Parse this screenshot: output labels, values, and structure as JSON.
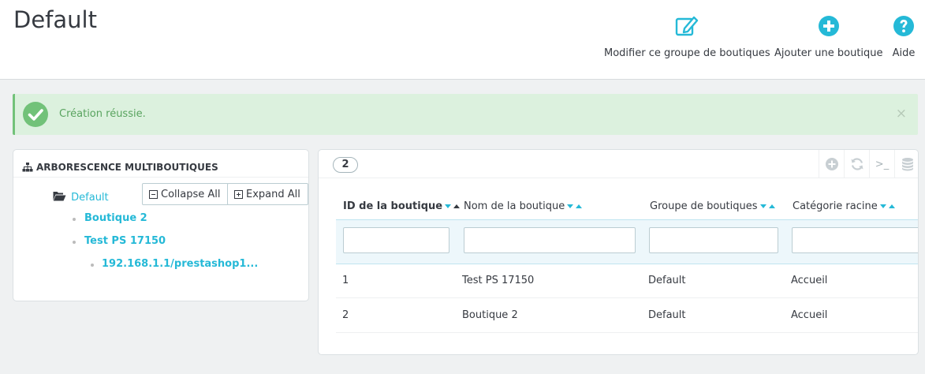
{
  "header": {
    "title": "Default",
    "toolbar": [
      {
        "label": "Modifier ce groupe de boutiques",
        "icon": "edit-icon"
      },
      {
        "label": "Ajouter une boutique",
        "icon": "add-circle-icon"
      },
      {
        "label": "Aide",
        "icon": "help-icon"
      }
    ]
  },
  "alert": {
    "message": "Création réussie.",
    "close": "×",
    "icon": "check-circle-icon"
  },
  "tree": {
    "title": "Arborescence multiboutiques",
    "collapse_label": "Collapse All",
    "expand_label": "Expand All",
    "root": "Default",
    "shops": [
      "Boutique 2",
      "Test PS 17150"
    ],
    "url": "192.168.1.1/prestashop1..."
  },
  "list": {
    "count": "2",
    "columns": [
      "ID de la boutique",
      "Nom de la boutique",
      "Groupe de boutiques",
      "Catégorie racine"
    ],
    "rows": [
      [
        "1",
        "Test PS 17150",
        "Default",
        "Accueil"
      ],
      [
        "2",
        "Boutique 2",
        "Default",
        "Accueil"
      ]
    ],
    "sql_label": ">_"
  },
  "colors": {
    "accent": "#25b9d7",
    "success_bg": "#dcf1de",
    "success_text": "#58a35e",
    "success_icon": "#72c279"
  }
}
